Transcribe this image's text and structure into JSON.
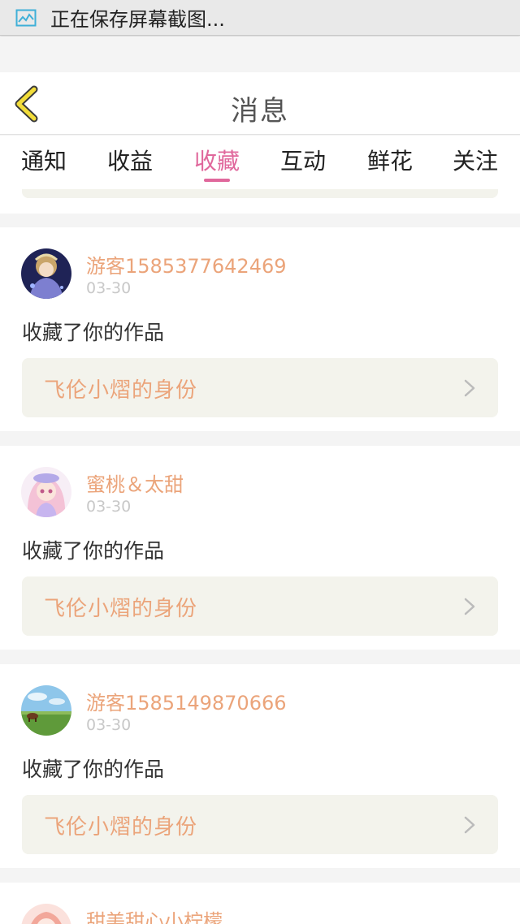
{
  "status_bar": {
    "icon": "screenshot-icon",
    "text": "正在保存屏幕截图..."
  },
  "header": {
    "back_icon": "chevron-left-icon",
    "title": "消息"
  },
  "tabs": [
    {
      "label": "通知",
      "active": false
    },
    {
      "label": "收益",
      "active": false
    },
    {
      "label": "收藏",
      "active": true
    },
    {
      "label": "互动",
      "active": false
    },
    {
      "label": "鲜花",
      "active": false
    },
    {
      "label": "关注",
      "active": false
    }
  ],
  "messages": [
    {
      "username": "游客1585377642469",
      "date": "03-30",
      "action": "收藏了你的作品",
      "work_title": "飞伦小熠的身份"
    },
    {
      "username": "蜜桃＆太甜",
      "date": "03-30",
      "action": "收藏了你的作品",
      "work_title": "飞伦小熠的身份"
    },
    {
      "username": "游客1585149870666",
      "date": "03-30",
      "action": "收藏了你的作品",
      "work_title": "飞伦小熠的身份"
    },
    {
      "username": "甜美甜心小柠檬",
      "date": "",
      "action": "",
      "work_title": ""
    }
  ],
  "colors": {
    "accent_pink": "#e0689c",
    "username_orange": "#eba47a",
    "back_icon_yellow": "#f2dd3a",
    "work_box_bg": "#f3f3ec"
  }
}
